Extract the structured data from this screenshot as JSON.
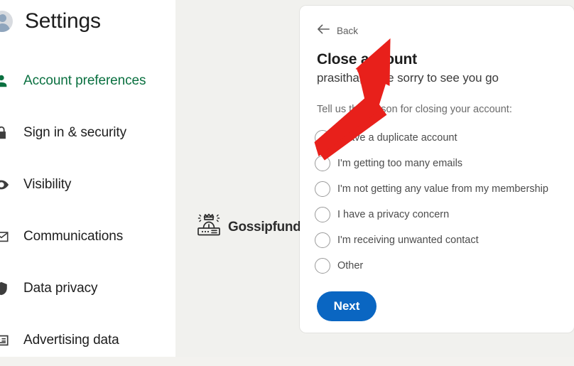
{
  "sidebar": {
    "title": "Settings",
    "avatar_icon": "user-avatar-icon",
    "items": [
      {
        "label": "Account preferences",
        "icon": "person-icon",
        "active": true
      },
      {
        "label": "Sign in & security",
        "icon": "lock-icon",
        "active": false
      },
      {
        "label": "Visibility",
        "icon": "eye-icon",
        "active": false
      },
      {
        "label": "Communications",
        "icon": "envelope-icon",
        "active": false
      },
      {
        "label": "Data privacy",
        "icon": "shield-icon",
        "active": false
      },
      {
        "label": "Advertising data",
        "icon": "ad-card-icon",
        "active": false
      }
    ],
    "active_color": "#0a7040"
  },
  "watermark": {
    "text": "Gossipfunda",
    "icon": "gossipfunda-logo-icon"
  },
  "annotation": {
    "arrow_color": "#e8201b",
    "arrow_icon": "red-pointer-arrow"
  },
  "card": {
    "back_label": "Back",
    "back_icon": "arrow-left-icon",
    "title": "Close account",
    "subtitle": "prasitha, we're sorry to see you go",
    "prompt": "Tell us the reason for closing your account:",
    "options": [
      {
        "label": "I have a duplicate account",
        "selected": false
      },
      {
        "label": "I'm getting too many emails",
        "selected": false
      },
      {
        "label": "I'm not getting any value from my membership",
        "selected": false
      },
      {
        "label": "I have a privacy concern",
        "selected": false
      },
      {
        "label": "I'm receiving unwanted contact",
        "selected": false
      },
      {
        "label": "Other",
        "selected": false
      }
    ],
    "next_label": "Next",
    "next_color": "#0a66c2"
  }
}
